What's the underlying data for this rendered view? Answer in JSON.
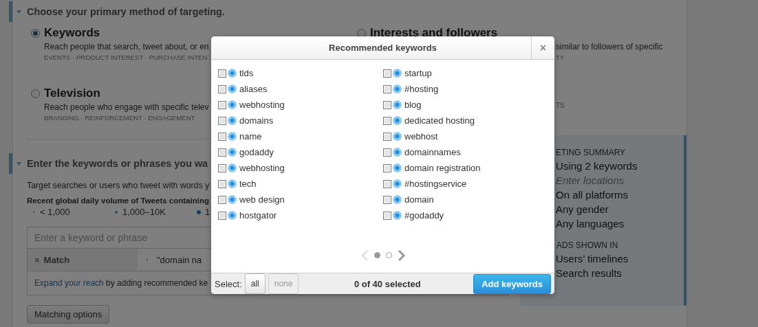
{
  "targeting": {
    "heading": "Choose your primary method of targeting.",
    "methods": [
      {
        "title": "Keywords",
        "selected": true,
        "description": "Reach people that search, tweet about, or en",
        "tags": "EVENTS · PRODUCT INTEREST · PURCHASE INTEN"
      },
      {
        "title": "Interests and followers",
        "selected": false,
        "description": "similar to followers of specific",
        "tags": "TY"
      },
      {
        "title": "Television",
        "selected": false,
        "description": "Reach people who engage with specific telev",
        "tags": "BRANDING · REINFORCEMENT · ENGAGEMENT"
      },
      {
        "tags": "TS"
      }
    ]
  },
  "keywords_section": {
    "heading": "Enter the keywords or phrases you wa",
    "intro": "Target searches or users who tweet with words y",
    "volume_heading": "Recent global daily volume of Tweets containing",
    "volume_legend": [
      {
        "kind": "small",
        "label": "< 1,000"
      },
      {
        "kind": "medium",
        "label": "1,000–10K"
      },
      {
        "kind": "large",
        "label": "1"
      }
    ],
    "input": {
      "placeholder": "Enter a keyword or phrase"
    },
    "match_row": {
      "remove": "×",
      "label": "Match",
      "keyword": "\"domain na"
    },
    "expand": {
      "link": "Expand your reach",
      "text": " by adding recommended ke"
    },
    "matching_options_button": "Matching options"
  },
  "summary": {
    "heading": "ETING SUMMARY",
    "items": [
      {
        "text": "Using 2 keywords",
        "kind": "plain"
      },
      {
        "text": "Enter locations",
        "kind": "hint"
      },
      {
        "text": "On all platforms",
        "kind": "plain"
      },
      {
        "text": "Any gender",
        "kind": "plain"
      },
      {
        "text": "Any languages",
        "kind": "plain"
      }
    ],
    "ads_heading": "ADS SHOWN IN",
    "ads_items": [
      "Users’ timelines",
      "Search results"
    ]
  },
  "modal": {
    "title": "Recommended keywords",
    "close": "×",
    "columns": [
      [
        {
          "label": "tlds",
          "checked": false
        },
        {
          "label": "aliases",
          "checked": false
        },
        {
          "label": "webhosting",
          "checked": false
        },
        {
          "label": "domains",
          "checked": false
        },
        {
          "label": "name",
          "checked": false
        },
        {
          "label": "godaddy",
          "checked": false
        },
        {
          "label": "webhosting",
          "checked": false
        },
        {
          "label": "tech",
          "checked": false
        },
        {
          "label": "web design",
          "checked": false
        },
        {
          "label": "hostgator",
          "checked": false
        }
      ],
      [
        {
          "label": "startup",
          "checked": false
        },
        {
          "label": "#hosting",
          "checked": false
        },
        {
          "label": "blog",
          "checked": false
        },
        {
          "label": "dedicated hosting",
          "checked": false
        },
        {
          "label": "webhost",
          "checked": false
        },
        {
          "label": "domainnames",
          "checked": false
        },
        {
          "label": "domain registration",
          "checked": false
        },
        {
          "label": "#hostingservice",
          "checked": false
        },
        {
          "label": "domain",
          "checked": false
        },
        {
          "label": "#godaddy",
          "checked": false
        }
      ]
    ],
    "pagination": {
      "prev_disabled": true,
      "next_disabled": false,
      "pages": [
        {
          "selected": true
        },
        {
          "selected": false
        }
      ]
    },
    "select_label": "Select:",
    "select_buttons": [
      {
        "label": "all",
        "disabled": false
      },
      {
        "label": "none",
        "disabled": true
      }
    ],
    "count": "0 of 40 selected",
    "add_button": "Add keywords"
  }
}
